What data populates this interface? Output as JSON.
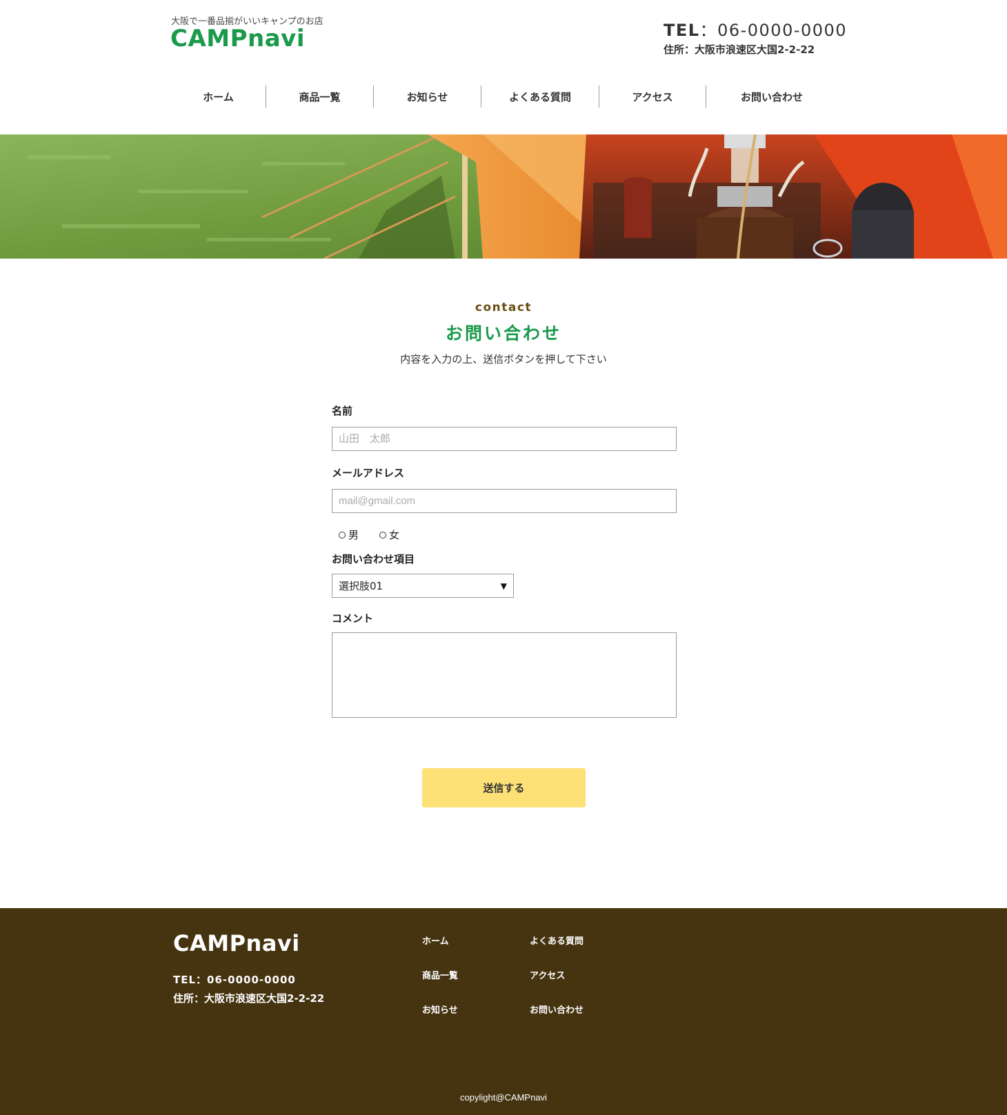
{
  "header": {
    "tagline": "大阪で一番品揃がいいキャンプのお店",
    "logo": "CAMPnavi",
    "tel_label": "TEL",
    "tel_sep": "：",
    "tel_number": "06-0000-0000",
    "address": "住所：大阪市浪速区大国2-2-22"
  },
  "nav": {
    "items": [
      {
        "label": "ホーム"
      },
      {
        "label": "商品一覧"
      },
      {
        "label": "お知らせ"
      },
      {
        "label": "よくある質問"
      },
      {
        "label": "アクセス"
      },
      {
        "label": "お問い合わせ"
      }
    ]
  },
  "section": {
    "en": "contact",
    "title": "お問い合わせ",
    "lead": "内容を入力の上、送信ボタンを押して下さい"
  },
  "form": {
    "name_label": "名前",
    "name_placeholder": "山田　太郎",
    "email_label": "メールアドレス",
    "email_placeholder": "mail@gmail.com",
    "radio_male": "男",
    "radio_female": "女",
    "inquiry_label": "お問い合わせ項目",
    "inquiry_selected": "選択肢01",
    "inquiry_caret": "▼",
    "comment_label": "コメント",
    "submit_label": "送信する"
  },
  "footer": {
    "logo": "CAMPnavi",
    "tel": "TEL：06-0000-0000",
    "address": "住所：大阪市浪速区大国2-2-22",
    "links": [
      {
        "label": "ホーム"
      },
      {
        "label": "商品一覧"
      },
      {
        "label": "お知らせ"
      },
      {
        "label": "よくある質問"
      },
      {
        "label": "アクセス"
      },
      {
        "label": "お問い合わせ"
      }
    ],
    "copyright": "copylight@CAMPnavi"
  },
  "colors": {
    "brand_green": "#1a9a4a",
    "footer_brown": "#463411",
    "accent_brown": "#6b4d12",
    "submit_yellow": "#fde177"
  }
}
